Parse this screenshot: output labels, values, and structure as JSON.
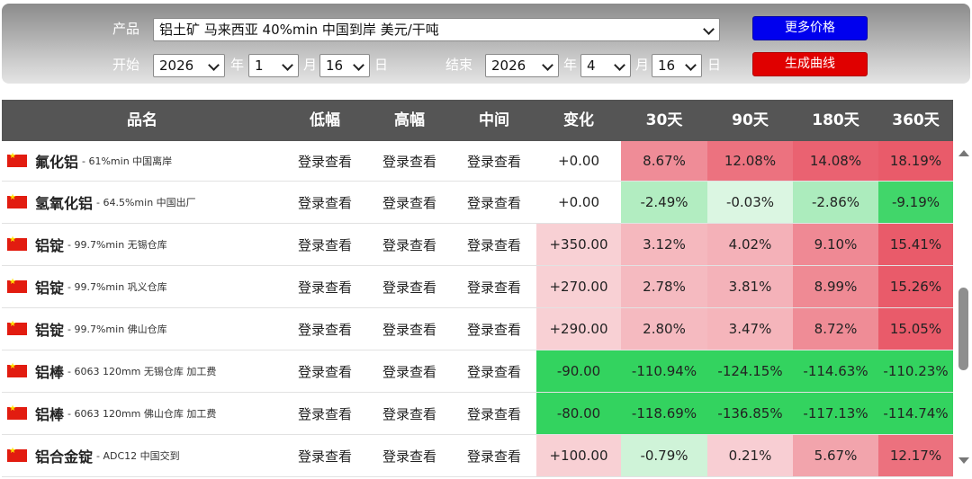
{
  "controls": {
    "product_label": "产品",
    "product_value": "铝土矿 马来西亚 40%min 中国到岸 美元/干吨",
    "more_prices": "更多价格",
    "start_label": "开始",
    "end_label": "结束",
    "generate_curve": "生成曲线",
    "year_unit": "年",
    "month_unit": "月",
    "day_unit": "日",
    "start": {
      "year": "2026",
      "month": "1",
      "day": "16"
    },
    "end": {
      "year": "2026",
      "month": "4",
      "day": "16"
    }
  },
  "table": {
    "headers": [
      "品名",
      "低幅",
      "高幅",
      "中间",
      "变化",
      "30天",
      "90天",
      "180天",
      "360天"
    ],
    "rows": [
      {
        "name": "氟化铝",
        "spec": "- 61%min 中国离岸",
        "low": "登录查看",
        "high": "登录查看",
        "mid": "登录查看",
        "change": "+0.00",
        "d30": "8.67%",
        "d90": "12.08%",
        "d180": "14.08%",
        "d360": "18.19%"
      },
      {
        "name": "氢氧化铝",
        "spec": "- 64.5%min 中国出厂",
        "low": "登录查看",
        "high": "登录查看",
        "mid": "登录查看",
        "change": "+0.00",
        "d30": "-2.49%",
        "d90": "-0.03%",
        "d180": "-2.86%",
        "d360": "-9.19%"
      },
      {
        "name": "铝锭",
        "spec": "- 99.7%min 无锡仓库",
        "low": "登录查看",
        "high": "登录查看",
        "mid": "登录查看",
        "change": "+350.00",
        "d30": "3.12%",
        "d90": "4.02%",
        "d180": "9.10%",
        "d360": "15.41%"
      },
      {
        "name": "铝锭",
        "spec": "- 99.7%min 巩义仓库",
        "low": "登录查看",
        "high": "登录查看",
        "mid": "登录查看",
        "change": "+270.00",
        "d30": "2.78%",
        "d90": "3.81%",
        "d180": "8.99%",
        "d360": "15.26%"
      },
      {
        "name": "铝锭",
        "spec": "- 99.7%min 佛山仓库",
        "low": "登录查看",
        "high": "登录查看",
        "mid": "登录查看",
        "change": "+290.00",
        "d30": "2.80%",
        "d90": "3.47%",
        "d180": "8.72%",
        "d360": "15.05%"
      },
      {
        "name": "铝棒",
        "spec": "- 6063 120mm 无锡仓库 加工费",
        "low": "登录查看",
        "high": "登录查看",
        "mid": "登录查看",
        "change": "-90.00",
        "d30": "-110.94%",
        "d90": "-124.15%",
        "d180": "-114.63%",
        "d360": "-110.23%"
      },
      {
        "name": "铝棒",
        "spec": "- 6063 120mm 佛山仓库 加工费",
        "low": "登录查看",
        "high": "登录查看",
        "mid": "登录查看",
        "change": "-80.00",
        "d30": "-118.69%",
        "d90": "-136.85%",
        "d180": "-117.13%",
        "d360": "-114.74%"
      },
      {
        "name": "铝合金锭",
        "spec": "- ADC12 中国交到",
        "low": "登录查看",
        "high": "登录查看",
        "mid": "登录查看",
        "change": "+100.00",
        "d30": "-0.79%",
        "d90": "0.21%",
        "d180": "5.67%",
        "d360": "12.17%"
      }
    ]
  },
  "colors": {
    "header_bg": "#555555",
    "more_button": "#0000ee",
    "curve_button": "#e00000",
    "positive_strong": "#e95b6a",
    "positive_weak": "#f8d0d4",
    "negative_strong": "#33d35f",
    "negative_weak": "#dcf6e2"
  }
}
